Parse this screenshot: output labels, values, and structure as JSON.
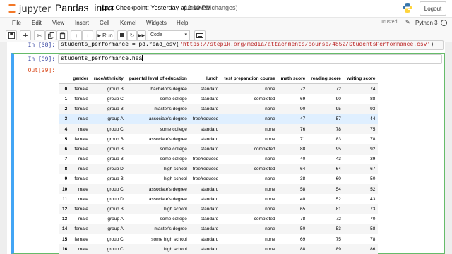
{
  "header": {
    "logo_text": "jupyter",
    "notebook_name": "Pandas_intro",
    "checkpoint": "Last Checkpoint: Yesterday at 2:10 PM",
    "unsaved": "(unsaved changes)",
    "logout": "Logout"
  },
  "menu": {
    "items": [
      "File",
      "Edit",
      "View",
      "Insert",
      "Cell",
      "Kernel",
      "Widgets",
      "Help"
    ],
    "trusted": "Trusted",
    "kernel": "Python 3"
  },
  "toolbar": {
    "save_icon": "floppy-icon",
    "add_icon": "plus-icon",
    "cut_icon": "scissors-icon",
    "copy_icon": "copy-icon",
    "paste_icon": "clipboard-icon",
    "up_icon": "arrow-up-icon",
    "down_icon": "arrow-down-icon",
    "run_label": "Run",
    "stop_icon": "stop-icon",
    "restart_icon": "restart-icon",
    "fastforward_icon": "fast-forward-icon",
    "cell_type": "Code",
    "keyboard_icon": "keyboard-icon"
  },
  "cells": {
    "c38": {
      "prompt": "In [38]:",
      "code_var": "students_performance = pd.read_csv(",
      "code_str": "'https://stepik.org/media/attachments/course/4852/StudentsPerformance.csv'",
      "code_end": ")"
    },
    "c39": {
      "prompt": "In [39]:",
      "code": "students_performance.hea",
      "out_prompt": "Out[39]:"
    }
  },
  "table": {
    "columns": [
      "",
      "gender",
      "race/ethnicity",
      "parental level of education",
      "lunch",
      "test preparation course",
      "math score",
      "reading score",
      "writing score"
    ],
    "rows": [
      [
        "0",
        "female",
        "group B",
        "bachelor's degree",
        "standard",
        "none",
        "72",
        "72",
        "74"
      ],
      [
        "1",
        "female",
        "group C",
        "some college",
        "standard",
        "completed",
        "69",
        "90",
        "88"
      ],
      [
        "2",
        "female",
        "group B",
        "master's degree",
        "standard",
        "none",
        "90",
        "95",
        "93"
      ],
      [
        "3",
        "male",
        "group A",
        "associate's degree",
        "free/reduced",
        "none",
        "47",
        "57",
        "44"
      ],
      [
        "4",
        "male",
        "group C",
        "some college",
        "standard",
        "none",
        "76",
        "78",
        "75"
      ],
      [
        "5",
        "female",
        "group B",
        "associate's degree",
        "standard",
        "none",
        "71",
        "83",
        "78"
      ],
      [
        "6",
        "female",
        "group B",
        "some college",
        "standard",
        "completed",
        "88",
        "95",
        "92"
      ],
      [
        "7",
        "male",
        "group B",
        "some college",
        "free/reduced",
        "none",
        "40",
        "43",
        "39"
      ],
      [
        "8",
        "male",
        "group D",
        "high school",
        "free/reduced",
        "completed",
        "64",
        "64",
        "67"
      ],
      [
        "9",
        "female",
        "group B",
        "high school",
        "free/reduced",
        "none",
        "38",
        "60",
        "50"
      ],
      [
        "10",
        "male",
        "group C",
        "associate's degree",
        "standard",
        "none",
        "58",
        "54",
        "52"
      ],
      [
        "11",
        "male",
        "group D",
        "associate's degree",
        "standard",
        "none",
        "40",
        "52",
        "43"
      ],
      [
        "12",
        "female",
        "group B",
        "high school",
        "standard",
        "none",
        "65",
        "81",
        "73"
      ],
      [
        "13",
        "male",
        "group A",
        "some college",
        "standard",
        "completed",
        "78",
        "72",
        "70"
      ],
      [
        "14",
        "female",
        "group A",
        "master's degree",
        "standard",
        "none",
        "50",
        "53",
        "58"
      ],
      [
        "15",
        "female",
        "group C",
        "some high school",
        "standard",
        "none",
        "69",
        "75",
        "78"
      ],
      [
        "16",
        "male",
        "group C",
        "high school",
        "standard",
        "none",
        "88",
        "89",
        "86"
      ]
    ],
    "highlighted_row": 3
  }
}
